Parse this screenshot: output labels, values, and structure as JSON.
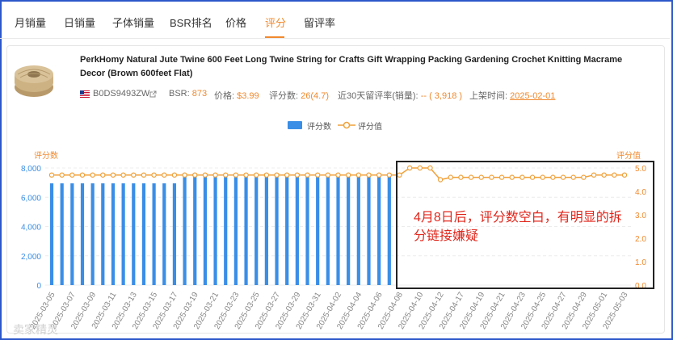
{
  "tabs": [
    "月销量",
    "日销量",
    "子体销量",
    "BSR排名",
    "价格",
    "评分",
    "留评率"
  ],
  "active_tab": "评分",
  "product": {
    "title": "PerkHomy Natural Jute Twine 600 Feet Long Twine String for Crafts Gift Wrapping Packing Gardening Crochet Knitting Macrame Decor (Brown 600feet Flat)",
    "asin": "B0DS9493ZW",
    "bsr_label": "BSR:",
    "bsr_value": "873",
    "price_label": "价格:",
    "price_value": "$3.99",
    "rating_label": "评分数:",
    "rating_value": "26(4.7)",
    "review_rate_label": "近30天留评率(销量):",
    "review_rate_value": "-- ( 3,918 )",
    "listed_label": "上架时间:",
    "listed_value": "2025-02-01"
  },
  "annotation": "4月8日后，评分数空白，有明显的拆分链接嫌疑",
  "watermark": "卖家精灵",
  "colors": {
    "bar": "#3a8ee6",
    "line": "#f0a13a",
    "accent": "#f0892d",
    "annotation": "#e0261b",
    "frame": "#2b57c9"
  },
  "chart_data": {
    "type": "bar+line",
    "legend": [
      {
        "name": "评分数",
        "type": "bar"
      },
      {
        "name": "评分值",
        "type": "line"
      }
    ],
    "y_left": {
      "label": "评分数",
      "ticks": [
        "0",
        "2,000",
        "4,000",
        "6,000",
        "8,000"
      ],
      "range": [
        0,
        8000
      ]
    },
    "y_right": {
      "label": "评分值",
      "ticks": [
        "0.0",
        "1.0",
        "2.0",
        "3.0",
        "4.0",
        "5.0"
      ],
      "range": [
        0,
        5
      ]
    },
    "x_tick_labels": [
      "2025-03-05",
      "2025-03-07",
      "2025-03-09",
      "2025-03-11",
      "2025-03-13",
      "2025-03-15",
      "2025-03-17",
      "2025-03-19",
      "2025-03-21",
      "2025-03-23",
      "2025-03-25",
      "2025-03-27",
      "2025-03-29",
      "2025-03-31",
      "2025-04-02",
      "2025-04-04",
      "2025-04-06",
      "2025-04-08",
      "2025-04-10",
      "2025-04-12",
      "2025-04-17",
      "2025-04-19",
      "2025-04-21",
      "2025-04-23",
      "2025-04-25",
      "2025-04-27",
      "2025-04-29",
      "2025-05-01",
      "2025-05-03"
    ],
    "bar_values": [
      6950,
      6950,
      6950,
      6950,
      6950,
      6950,
      6950,
      6950,
      6950,
      6950,
      6950,
      6950,
      6950,
      7400,
      7400,
      7400,
      7400,
      7400,
      7400,
      7400,
      7400,
      7400,
      7400,
      7400,
      7400,
      7400,
      7400,
      7400,
      7400,
      7400,
      7400,
      7400,
      7400,
      7400,
      null,
      null,
      null,
      null,
      null,
      null,
      null,
      null,
      null,
      null,
      null,
      null,
      null,
      null,
      null,
      null,
      null,
      null,
      null,
      null,
      null,
      null,
      null
    ],
    "rating_values": [
      4.7,
      4.7,
      4.7,
      4.7,
      4.7,
      4.7,
      4.7,
      4.7,
      4.7,
      4.7,
      4.7,
      4.7,
      4.7,
      4.7,
      4.7,
      4.7,
      4.7,
      4.7,
      4.7,
      4.7,
      4.7,
      4.7,
      4.7,
      4.7,
      4.7,
      4.7,
      4.7,
      4.7,
      4.7,
      4.7,
      4.7,
      4.7,
      4.7,
      4.7,
      4.7,
      5.0,
      5.0,
      5.0,
      4.5,
      4.6,
      4.6,
      4.6,
      4.6,
      4.6,
      4.6,
      4.6,
      4.6,
      4.6,
      4.6,
      4.6,
      4.6,
      4.6,
      4.6,
      4.7,
      4.7,
      4.7,
      4.7
    ]
  }
}
